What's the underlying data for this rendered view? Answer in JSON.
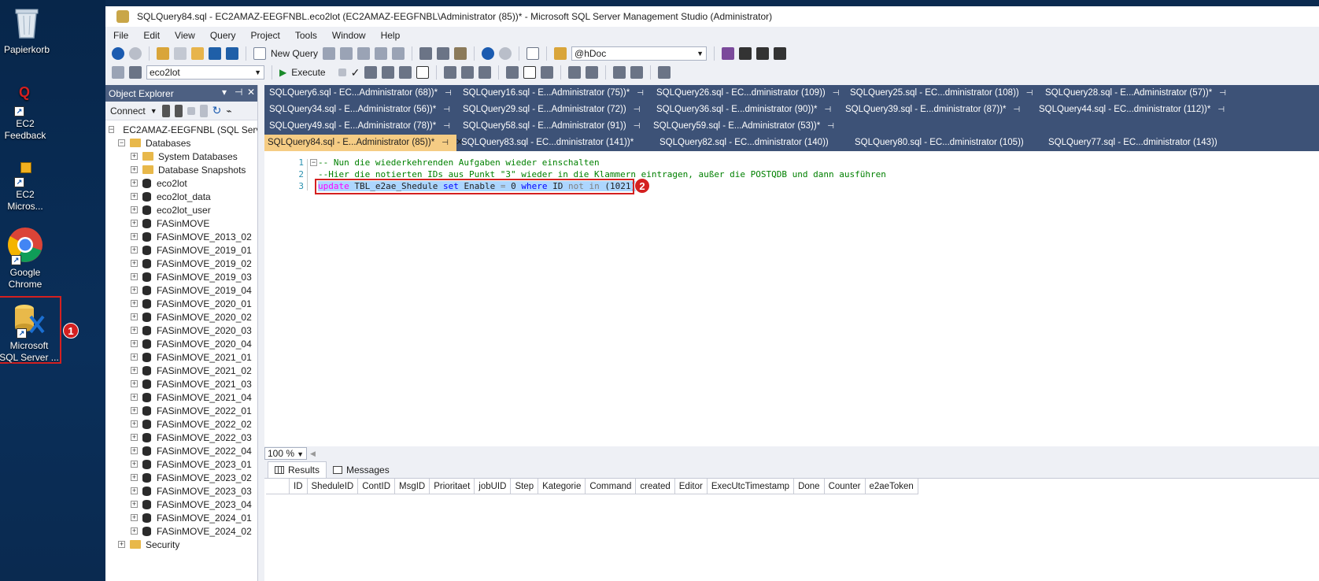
{
  "desktop": {
    "icons": [
      {
        "label": "Papierkorb"
      },
      {
        "label": "EC2\nFeedback"
      },
      {
        "label": "EC2\nMicros..."
      },
      {
        "label": "Google\nChrome"
      },
      {
        "label": "Microsoft\nSQL Server ..."
      }
    ],
    "callout1": "1"
  },
  "window": {
    "title": "SQLQuery84.sql - EC2AMAZ-EEGFNBL.eco2lot (EC2AMAZ-EEGFNBL\\Administrator (85))* - Microsoft SQL Server Management Studio (Administrator)"
  },
  "menu": [
    "File",
    "Edit",
    "View",
    "Query",
    "Project",
    "Tools",
    "Window",
    "Help"
  ],
  "toolbar1": {
    "new_query": "New Query",
    "search_combo": "@hDoc"
  },
  "toolbar2": {
    "database_combo": "eco2lot",
    "execute": "Execute"
  },
  "object_explorer": {
    "title": "Object Explorer",
    "connect": "Connect",
    "server": "EC2AMAZ-EEGFNBL (SQL Server",
    "databases": "Databases",
    "system_databases": "System Databases",
    "database_snapshots": "Database Snapshots",
    "items": [
      "eco2lot",
      "eco2lot_data",
      "eco2lot_user",
      "FASinMOVE",
      "FASinMOVE_2013_02",
      "FASinMOVE_2019_01",
      "FASinMOVE_2019_02",
      "FASinMOVE_2019_03",
      "FASinMOVE_2019_04",
      "FASinMOVE_2020_01",
      "FASinMOVE_2020_02",
      "FASinMOVE_2020_03",
      "FASinMOVE_2020_04",
      "FASinMOVE_2021_01",
      "FASinMOVE_2021_02",
      "FASinMOVE_2021_03",
      "FASinMOVE_2021_04",
      "FASinMOVE_2022_01",
      "FASinMOVE_2022_02",
      "FASinMOVE_2022_03",
      "FASinMOVE_2022_04",
      "FASinMOVE_2023_01",
      "FASinMOVE_2023_02",
      "FASinMOVE_2023_03",
      "FASinMOVE_2023_04",
      "FASinMOVE_2024_01",
      "FASinMOVE_2024_02"
    ],
    "security": "Security"
  },
  "tabs": {
    "row1": [
      "SQLQuery6.sql - EC...Administrator (68))*",
      "SQLQuery16.sql - E...Administrator (75))*",
      "SQLQuery26.sql - EC...dministrator (109))",
      "SQLQuery25.sql - EC...dministrator (108))",
      "SQLQuery28.sql - E...Administrator (57))*"
    ],
    "row2": [
      "SQLQuery34.sql - E...Administrator (56))*",
      "SQLQuery29.sql - E...Administrator (72))",
      "SQLQuery36.sql - E...dministrator (90))*",
      "SQLQuery39.sql - E...dministrator (87))*",
      "SQLQuery44.sql - EC...dministrator (112))*"
    ],
    "row3": [
      "SQLQuery49.sql - E...Administrator (78))*",
      "SQLQuery58.sql - E...Administrator (91))",
      "SQLQuery59.sql - E...Administrator (53))*"
    ],
    "row4": [
      "SQLQuery84.sql - E...Administrator (85))*",
      "SQLQuery83.sql - EC...dministrator (141))*",
      "SQLQuery82.sql - EC...dministrator (140))",
      "SQLQuery80.sql - EC...dministrator (105))",
      "SQLQuery77.sql - EC...dministrator (143))"
    ]
  },
  "editor": {
    "line_numbers": [
      "1",
      "2",
      "3"
    ],
    "line1": "-- Nun die wiederkehrenden Aufgaben wieder einschalten",
    "line2": "--Hier die notierten IDs aus Punkt \"3\" wieder in die Klammern eintragen, außer die POSTQDB und dann ausführen",
    "line3": {
      "kw_update": "update",
      "table": " TBL_e2ae_Shedule ",
      "kw_set": "set",
      "col": " Enable ",
      "eq": "=",
      "val": " 0 ",
      "kw_where": "where",
      "id": " ID ",
      "kw_not": "not",
      "sp": " ",
      "kw_in": "in",
      "args": " (1021)"
    },
    "callout2": "2"
  },
  "zoom": "100 %",
  "results": {
    "tab_results": "Results",
    "tab_messages": "Messages",
    "columns": [
      "ID",
      "SheduleID",
      "ContID",
      "MsgID",
      "Prioritaet",
      "jobUID",
      "Step",
      "Kategorie",
      "Command",
      "created",
      "Editor",
      "ExecUtcTimestamp",
      "Done",
      "Counter",
      "e2aeToken"
    ]
  },
  "colors": {
    "tab_strip": "#3d5277",
    "active_tab": "#f5cc84",
    "callout": "#d42020",
    "highlight_box": "#d42020"
  }
}
